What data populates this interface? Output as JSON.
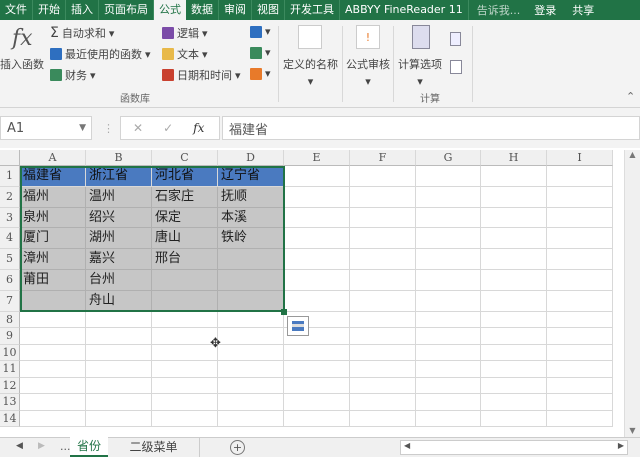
{
  "menubar": {
    "tabs": [
      "文件",
      "开始",
      "插入",
      "页面布局",
      "公式",
      "数据",
      "审阅",
      "视图",
      "开发工具",
      "ABBYY FineReader 11"
    ],
    "active": "公式",
    "tell_me": "告诉我...",
    "login": "登录",
    "share": "共享"
  },
  "ribbon": {
    "insert_function": "插入函数",
    "autosum": "自动求和",
    "recent": "最近使用的函数",
    "finance": "财务",
    "logic": "逻辑",
    "text": "文本",
    "datetime": "日期和时间",
    "group_library": "函数库",
    "defined_names": "定义的名称",
    "formula_audit": "公式审核",
    "calc_options": "计算选项",
    "group_calc": "计算"
  },
  "formula_bar": {
    "name_box": "A1",
    "value": "福建省"
  },
  "colors": {
    "accent": "#217346",
    "selection": "#c6c6c6",
    "header_fill": "#4a7ac0"
  },
  "sheet": {
    "columns": [
      "A",
      "B",
      "C",
      "D",
      "E",
      "F",
      "G",
      "H",
      "I"
    ],
    "rows": [
      "1",
      "2",
      "3",
      "4",
      "5",
      "6",
      "7",
      "8",
      "9",
      "10",
      "11",
      "12",
      "13",
      "14"
    ],
    "cells": [
      [
        "福建省",
        "浙江省",
        "河北省",
        "辽宁省"
      ],
      [
        "福州",
        "温州",
        "石家庄",
        "抚顺"
      ],
      [
        "泉州",
        "绍兴",
        "保定",
        "本溪"
      ],
      [
        "厦门",
        "湖州",
        "唐山",
        "铁岭"
      ],
      [
        "漳州",
        "嘉兴",
        "邢台",
        ""
      ],
      [
        "莆田",
        "台州",
        "",
        ""
      ],
      [
        "",
        "舟山",
        "",
        ""
      ]
    ]
  },
  "tabs": {
    "sheets": [
      "省份",
      "二级菜单"
    ],
    "active": "省份",
    "more": "..."
  }
}
